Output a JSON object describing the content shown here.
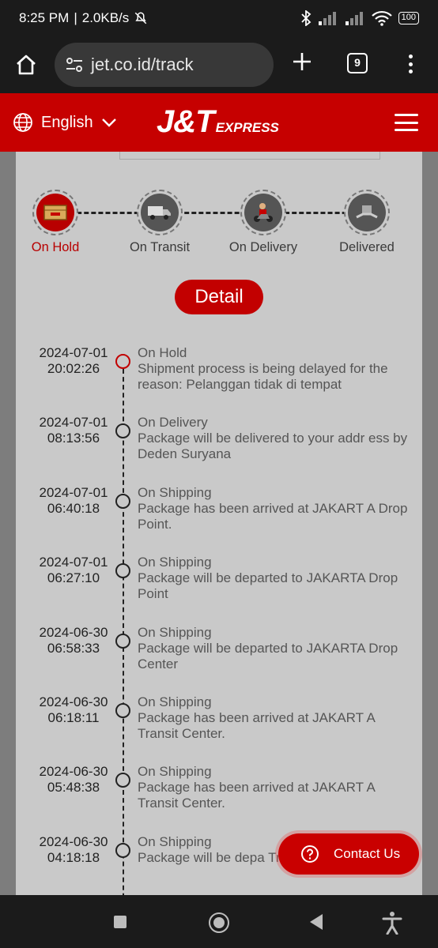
{
  "status_bar": {
    "time": "8:25 PM",
    "separator": "|",
    "speed": "2.0KB/s",
    "battery": "100"
  },
  "browser": {
    "url": "jet.co.id/track",
    "tab_count": "9"
  },
  "header": {
    "language": "English",
    "logo_main": "J&T",
    "logo_sub": "EXPRESS"
  },
  "steps": [
    {
      "label": "On Hold",
      "active": true
    },
    {
      "label": "On Transit",
      "active": false
    },
    {
      "label": "On Delivery",
      "active": false
    },
    {
      "label": "Delivered",
      "active": false
    }
  ],
  "detail_button": "Detail",
  "events": [
    {
      "date": "2024-07-01",
      "time": "20:02:26",
      "status": "On Hold",
      "desc": "Shipment process is being delayed for the reason: Pelanggan tidak di tempat"
    },
    {
      "date": "2024-07-01",
      "time": "08:13:56",
      "status": "On Delivery",
      "desc": "Package will be delivered to your addr ess by Deden Suryana"
    },
    {
      "date": "2024-07-01",
      "time": "06:40:18",
      "status": "On Shipping",
      "desc": "Package has been arrived at JAKART A Drop Point."
    },
    {
      "date": "2024-07-01",
      "time": "06:27:10",
      "status": "On Shipping",
      "desc": "Package will be departed to JAKARTA Drop Point"
    },
    {
      "date": "2024-06-30",
      "time": "06:58:33",
      "status": "On Shipping",
      "desc": "Package will be departed to JAKARTA Drop Center"
    },
    {
      "date": "2024-06-30",
      "time": "06:18:11",
      "status": "On Shipping",
      "desc": "Package has been arrived at JAKART A Transit Center."
    },
    {
      "date": "2024-06-30",
      "time": "05:48:38",
      "status": "On Shipping",
      "desc": "Package has been arrived at JAKART A Transit Center."
    },
    {
      "date": "2024-06-30",
      "time": "04:18:18",
      "status": "On Shipping",
      "desc": "Package will be depa Transit Center"
    }
  ],
  "contact_button": "Contact Us",
  "colors": {
    "brand_red": "#c60000",
    "page_gray": "#c9c9c9",
    "browser_dark": "#1b1b1b"
  }
}
